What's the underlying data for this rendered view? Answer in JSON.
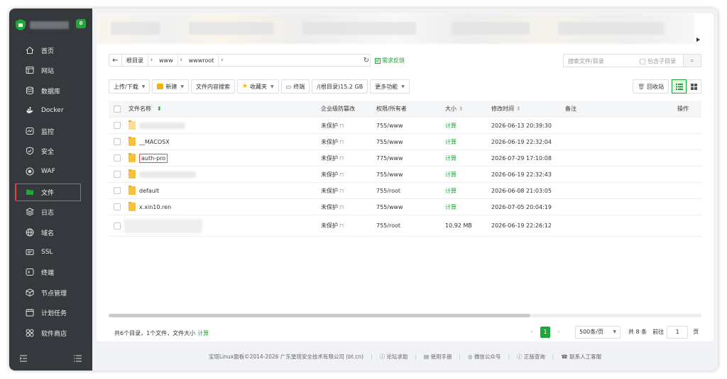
{
  "sidebar": {
    "badge": "0",
    "items": [
      {
        "label": "首页"
      },
      {
        "label": "网站"
      },
      {
        "label": "数据库"
      },
      {
        "label": "Docker"
      },
      {
        "label": "监控"
      },
      {
        "label": "安全"
      },
      {
        "label": "WAF"
      },
      {
        "label": "文件"
      },
      {
        "label": "日志"
      },
      {
        "label": "域名"
      },
      {
        "label": "SSL"
      },
      {
        "label": "终端"
      },
      {
        "label": "节点管理"
      },
      {
        "label": "计划任务"
      },
      {
        "label": "软件商店"
      }
    ]
  },
  "pathbar": {
    "crumbs": [
      "根目录",
      "www",
      "wwwroot"
    ],
    "feedback": "需求反馈"
  },
  "search": {
    "placeholder": "搜索文件/目录",
    "include_sub": "包含子目录"
  },
  "toolbar": {
    "upload": "上传/下载",
    "new": "新建",
    "content_search": "文件内容搜索",
    "favorites": "收藏夹",
    "terminal": "终端",
    "disk": "/(根目录)15.2 GB",
    "more": "更多功能",
    "recycle": "回收站"
  },
  "table": {
    "headers": {
      "name": "文件名称",
      "protection": "企业级防篡改",
      "perm": "权限/所有者",
      "size": "大小",
      "mtime": "修改时间",
      "note": "备注",
      "op": "操作"
    },
    "rows": [
      {
        "name": "",
        "protection": "未保护",
        "perm": "755/www",
        "size": "计算",
        "mtime": "2026-06-13 20:39:30"
      },
      {
        "name": "__MACOSX",
        "protection": "未保护",
        "perm": "755/www",
        "size": "计算",
        "mtime": "2026-06-19 22:32:04"
      },
      {
        "name": "auth-pro",
        "protection": "未保护",
        "perm": "775/www",
        "size": "计算",
        "mtime": "2026-07-29 17:10:08"
      },
      {
        "name": "",
        "protection": "未保护",
        "perm": "755/www",
        "size": "计算",
        "mtime": "2026-06-19 22:32:43"
      },
      {
        "name": "default",
        "protection": "未保护",
        "perm": "755/root",
        "size": "计算",
        "mtime": "2026-06-08 21:03:05"
      },
      {
        "name": "x.xin10.ren",
        "protection": "未保护",
        "perm": "755/www",
        "size": "计算",
        "mtime": "2026-07-05 20:04:19"
      },
      {
        "name": "",
        "protection": "未保护",
        "perm": "755/root",
        "size": "10.92 MB",
        "mtime": "2026-06-19 22:26:12"
      }
    ]
  },
  "summary": {
    "text": "共6个目录，1个文件，文件大小",
    "calc": "计算"
  },
  "pager": {
    "current": "1",
    "per_page": "500条/页",
    "total": "共 8 条",
    "goto": "前往",
    "goto_value": "1",
    "unit": "页"
  },
  "footer": {
    "copyright": "宝塔Linux面板©2014-2026 广东堡塔安全技术有限公司 (bt.cn)",
    "links": [
      "论坛求助",
      "使用手册",
      "微信公众号",
      "正版查询",
      "联系人工客服"
    ]
  },
  "colors": {
    "accent": "#20a53a",
    "sidebar_bg": "#35393d",
    "highlight": "#e0523d"
  }
}
